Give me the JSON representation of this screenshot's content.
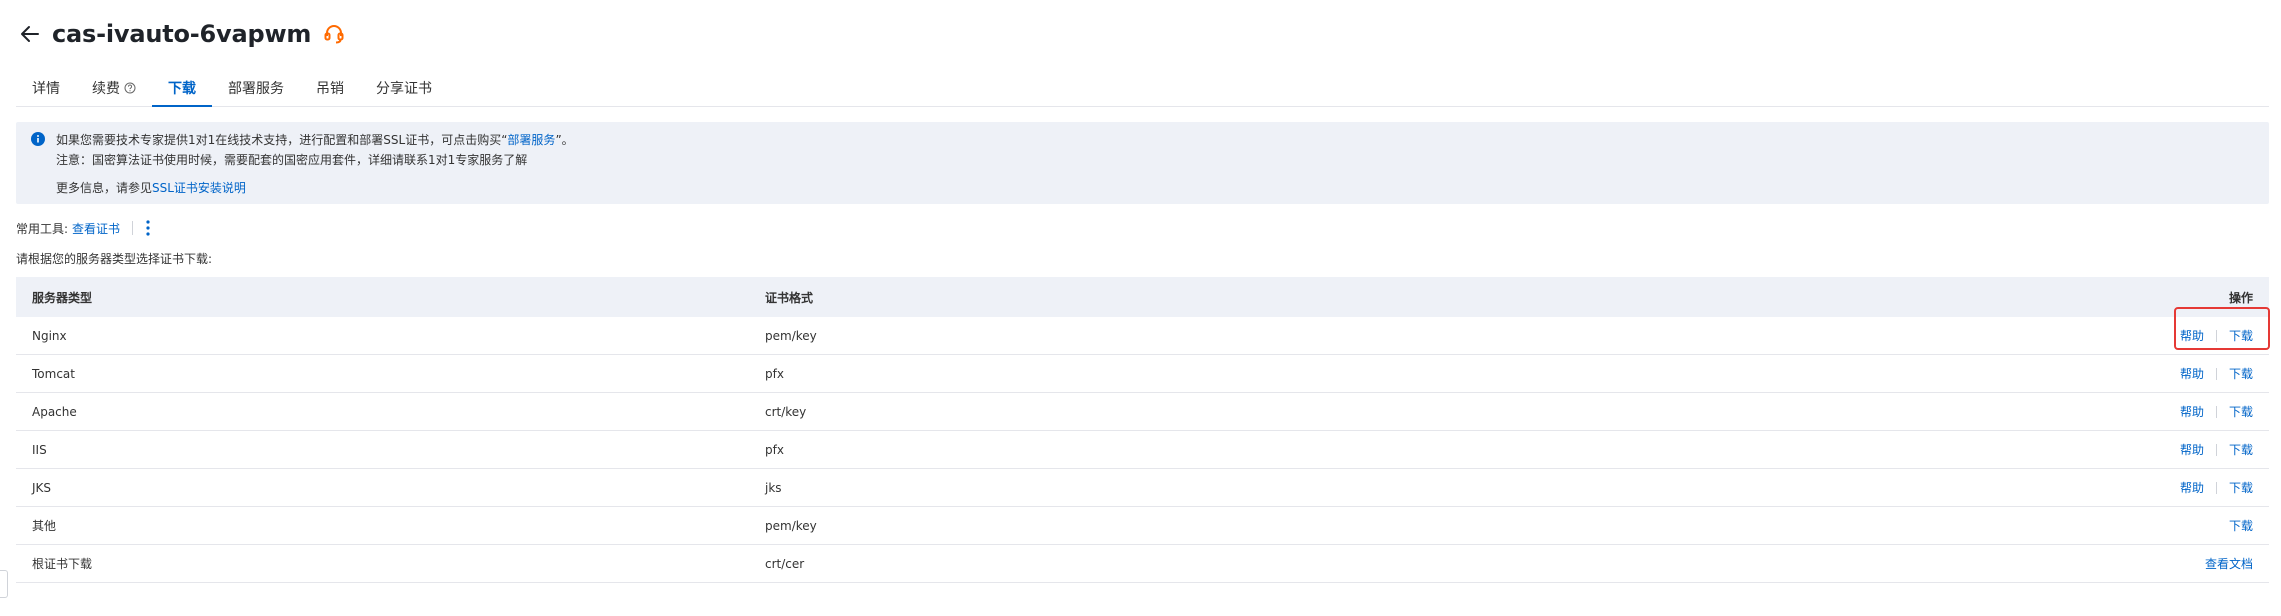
{
  "header": {
    "title": "cas-ivauto-6vapwm"
  },
  "tabs": [
    {
      "label": "详情"
    },
    {
      "label": "续费"
    },
    {
      "label": "下载"
    },
    {
      "label": "部署服务"
    },
    {
      "label": "吊销"
    },
    {
      "label": "分享证书"
    }
  ],
  "banner": {
    "line1_prefix": "如果您需要技术专家提供1对1在线技术支持，进行配置和部署SSL证书，可点击购买“",
    "line1_link": "部署服务",
    "line1_suffix": "”。",
    "line2": "注意：国密算法证书使用时候，需要配套的国密应用套件，详细请联系1对1专家服务了解",
    "line3_prefix": "更多信息，请参见",
    "line3_link": "SSL证书安装说明"
  },
  "tools": {
    "label": "常用工具:",
    "view_cert": "查看证书"
  },
  "instruction": "请根据您的服务器类型选择证书下载:",
  "table": {
    "headers": {
      "type": "服务器类型",
      "format": "证书格式",
      "action": "操作"
    },
    "rows": [
      {
        "type": "Nginx",
        "format": "pem/key",
        "help": "帮助",
        "download": "下载"
      },
      {
        "type": "Tomcat",
        "format": "pfx",
        "help": "帮助",
        "download": "下载"
      },
      {
        "type": "Apache",
        "format": "crt/key",
        "help": "帮助",
        "download": "下载"
      },
      {
        "type": "IIS",
        "format": "pfx",
        "help": "帮助",
        "download": "下载"
      },
      {
        "type": "JKS",
        "format": "jks",
        "help": "帮助",
        "download": "下载"
      },
      {
        "type": "其他",
        "format": "pem/key",
        "download": "下载"
      },
      {
        "type": "根证书下载",
        "format": "crt/cer",
        "view_doc": "查看文档"
      }
    ]
  },
  "colors": {
    "accent": "#0064c8",
    "highlight": "#e53935",
    "support_icon": "#ff6a00"
  }
}
